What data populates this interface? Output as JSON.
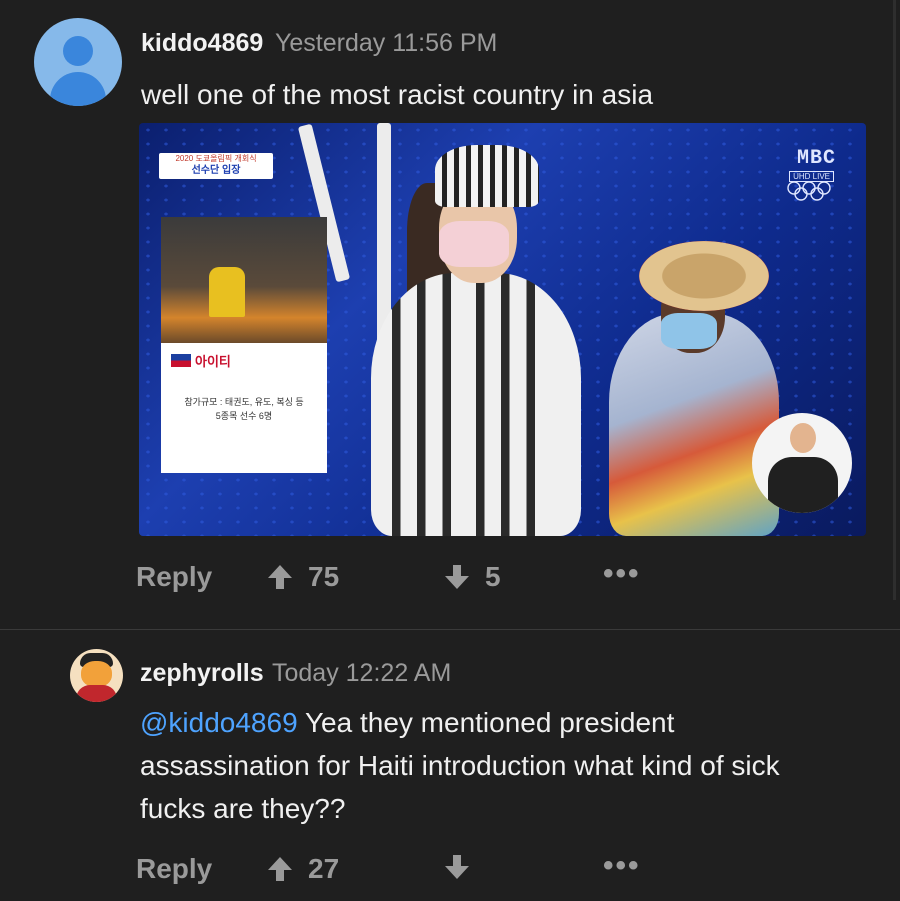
{
  "comments": [
    {
      "username": "kiddo4869",
      "timestamp": "Yesterday 11:56 PM",
      "text": "well one of the most racist country in asia",
      "image": {
        "broadcaster_logo": "MBC",
        "broadcaster_sub": "UHD LIVE",
        "banner_line1": "2020 도쿄올림픽 개회식",
        "banner_line2": "선수단 입장",
        "info_country": "아이티",
        "info_detail_line1": "참가규모 : 태권도, 유도, 복싱 등",
        "info_detail_line2": "5종목 선수 6명"
      },
      "actions": {
        "reply_label": "Reply",
        "upvotes": "75",
        "downvotes": "5",
        "more_label": "•••"
      }
    },
    {
      "username": "zephyrolls",
      "timestamp": "Today 12:22 AM",
      "mention": "@kiddo4869",
      "text_line1": "Yea they mentioned president",
      "text_line2": "assassination for Haiti introduction what kind of sick",
      "text_line3": "fucks are they??",
      "actions": {
        "reply_label": "Reply",
        "upvotes": "27",
        "more_label": "•••"
      }
    }
  ],
  "icons": {
    "avatar_1": "default-user-avatar",
    "avatar_2": "cartoon-avatar",
    "upvote": "upvote-arrow-icon",
    "downvote": "downvote-arrow-icon",
    "more": "more-options-icon"
  },
  "colors": {
    "background": "#1f1f1f",
    "mention": "#4ea3ff",
    "muted": "#9a9a9a"
  }
}
